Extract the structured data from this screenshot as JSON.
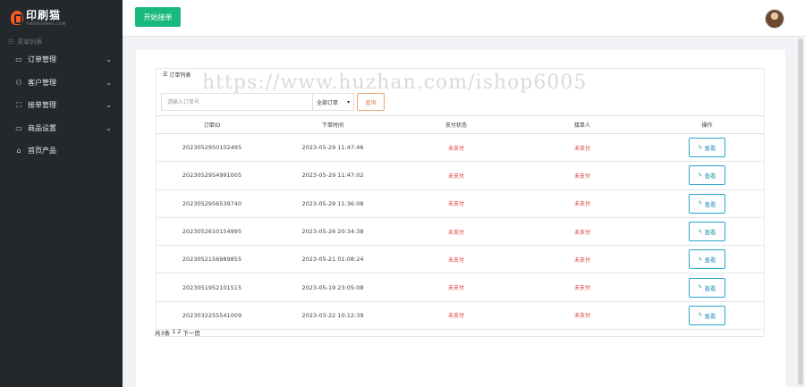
{
  "sidebar": {
    "logo_title": "印刷猫",
    "logo_subtitle": "YINSHUAMAO.COM",
    "caption": "菜单列表",
    "items": [
      {
        "label": "订单管理",
        "icon": "order-icon",
        "has_children": true
      },
      {
        "label": "客户管理",
        "icon": "customer-icon",
        "has_children": true
      },
      {
        "label": "接单管理",
        "icon": "receive-icon",
        "has_children": true
      },
      {
        "label": "商品设置",
        "icon": "monitor-icon",
        "has_children": true
      },
      {
        "label": "首页产品",
        "icon": "home-icon",
        "has_children": false
      }
    ]
  },
  "topbar": {
    "start_button": "开始接单"
  },
  "panel": {
    "title": "订单列表",
    "search_placeholder": "请输入订单号",
    "status_select": "全部订单",
    "query_button": "查询"
  },
  "table": {
    "columns": [
      "订单ID",
      "下单时间",
      "支付状态",
      "接单人",
      "操作"
    ],
    "view_label": "查看",
    "rows": [
      {
        "id": "2023052950102495",
        "time": "2023-05-29 11:47:46",
        "pay_status": "未支付",
        "taker": "未支付"
      },
      {
        "id": "2023052954991005",
        "time": "2023-05-29 11:47:02",
        "pay_status": "未支付",
        "taker": "未支付"
      },
      {
        "id": "2023052956539740",
        "time": "2023-05-29 11:36:08",
        "pay_status": "未支付",
        "taker": "未支付"
      },
      {
        "id": "2023052610154995",
        "time": "2023-05-26 20:34:38",
        "pay_status": "未支付",
        "taker": "未支付"
      },
      {
        "id": "2023052156989855",
        "time": "2023-05-21 01:08:24",
        "pay_status": "未支付",
        "taker": "未支付"
      },
      {
        "id": "2023051952101515",
        "time": "2023-05-19 23:05:08",
        "pay_status": "未支付",
        "taker": "未支付"
      },
      {
        "id": "2023032255541009",
        "time": "2023-03-22 10:12:39",
        "pay_status": "未支付",
        "taker": "未支付"
      }
    ]
  },
  "pager": {
    "total": "共3条",
    "page1": "1",
    "page2": "2",
    "next": "下一页"
  },
  "watermark": "https://www.huzhan.com/ishop6005",
  "colors": {
    "sidebar_bg": "#23282d",
    "primary_green": "#19b97e",
    "unpaid_red": "#d9342b",
    "view_blue": "#2aa5c8",
    "query_orange": "#e8713a"
  }
}
